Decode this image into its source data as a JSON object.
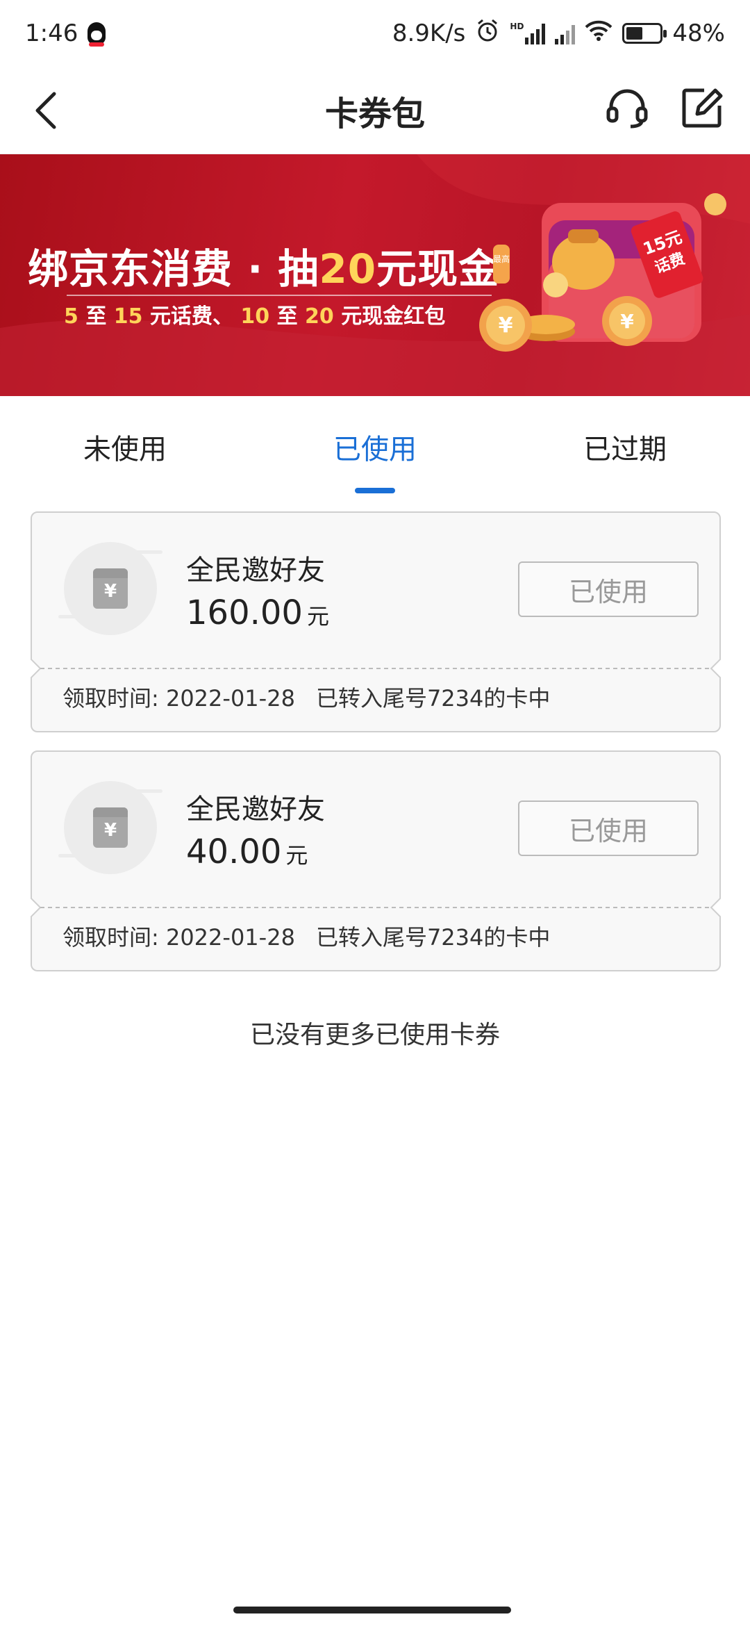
{
  "status": {
    "time": "1:46",
    "net_speed": "8.9K/s",
    "hd": "HD",
    "battery": "48%",
    "battery_level": 0.48
  },
  "nav": {
    "title": "卡券包",
    "back_icon": "chevron-left-icon",
    "service_icon": "headset-icon",
    "edit_icon": "edit-icon"
  },
  "banner": {
    "title_a": "绑京东消费 · 抽",
    "title_b": "20",
    "title_c": "元现金",
    "tag": "最高",
    "sub": [
      {
        "t": "5",
        "gold": true
      },
      {
        "t": " 至 ",
        "gold": false
      },
      {
        "t": "15",
        "gold": true
      },
      {
        "t": " 元话费、  ",
        "gold": false
      },
      {
        "t": "10",
        "gold": true
      },
      {
        "t": " 至 ",
        "gold": false
      },
      {
        "t": "20",
        "gold": true
      },
      {
        "t": " 元现金红包",
        "gold": false
      }
    ],
    "art_text": "15元话费"
  },
  "tabs": [
    {
      "label": "未使用",
      "active": false
    },
    {
      "label": "已使用",
      "active": true
    },
    {
      "label": "已过期",
      "active": false
    }
  ],
  "coupons": [
    {
      "name": "全民邀好友",
      "amount": "160.00",
      "unit": "元",
      "button": "已使用",
      "icon_symbol": "¥",
      "date_label": "领取时间: 2022-01-28",
      "note": "已转入尾号7234的卡中"
    },
    {
      "name": "全民邀好友",
      "amount": "40.00",
      "unit": "元",
      "button": "已使用",
      "icon_symbol": "¥",
      "date_label": "领取时间: 2022-01-28",
      "note": "已转入尾号7234的卡中"
    }
  ],
  "no_more": "已没有更多已使用卡券",
  "colors": {
    "accent": "#1a6fd6",
    "banner_red": "#b81527",
    "gold": "#ffd45a"
  }
}
